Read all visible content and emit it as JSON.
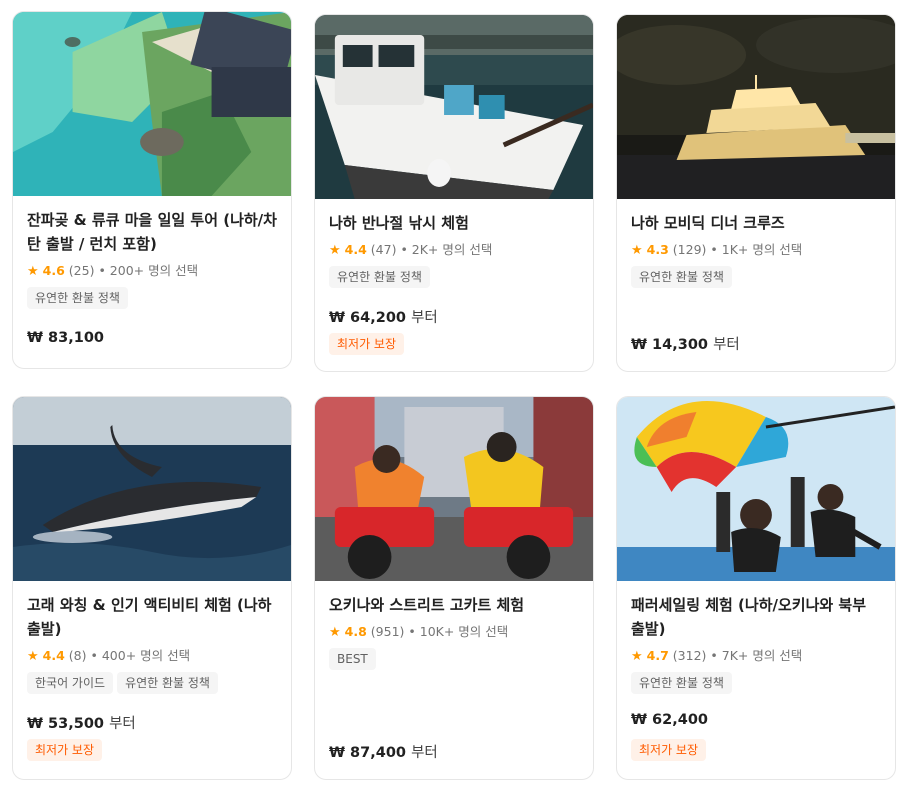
{
  "cards": [
    {
      "title": "잔파곶 & 류큐 마을 일일 투어 (나하/차탄 출발 / 런치 포함)",
      "star": "★",
      "rating": "4.6",
      "reviews": "(25)",
      "booked": "• 200+ 명의 선택",
      "tags": [
        "유연한 환불 정책"
      ],
      "price": "₩ 83,100",
      "price_suffix": "",
      "promo": ""
    },
    {
      "title": "나하 반나절 낚시 체험",
      "star": "★",
      "rating": "4.4",
      "reviews": "(47)",
      "booked": "• 2K+ 명의 선택",
      "tags": [
        "유연한 환불 정책"
      ],
      "price": "₩ 64,200",
      "price_suffix": "부터",
      "promo": "최저가 보장"
    },
    {
      "title": "나하 모비딕 디너 크루즈",
      "star": "★",
      "rating": "4.3",
      "reviews": "(129)",
      "booked": "• 1K+ 명의 선택",
      "tags": [
        "유연한 환불 정책"
      ],
      "price": "₩ 14,300",
      "price_suffix": "부터",
      "promo": ""
    },
    {
      "title": "고래 와칭 & 인기 액티비티 체험 (나하 출발)",
      "star": "★",
      "rating": "4.4",
      "reviews": "(8)",
      "booked": "• 400+ 명의 선택",
      "tags": [
        "한국어 가이드",
        "유연한 환불 정책"
      ],
      "price": "₩ 53,500",
      "price_suffix": "부터",
      "promo": "최저가 보장"
    },
    {
      "title": "오키나와 스트리트 고카트 체험",
      "star": "★",
      "rating": "4.8",
      "reviews": "(951)",
      "booked": "• 10K+ 명의 선택",
      "tags": [
        "BEST"
      ],
      "price": "₩ 87,400",
      "price_suffix": "부터",
      "promo": ""
    },
    {
      "title": "패러세일링 체험 (나하/오키나와 북부 출발)",
      "star": "★",
      "rating": "4.7",
      "reviews": "(312)",
      "booked": "• 7K+ 명의 선택",
      "tags": [
        "유연한 환불 정책"
      ],
      "price": "₩ 62,400",
      "price_suffix": "",
      "promo": "최저가 보장"
    }
  ],
  "colors": {
    "star": "#ff9900",
    "promo_text": "#ff5b00",
    "promo_bg": "#fff1e8",
    "tag_bg": "#f5f5f5"
  }
}
